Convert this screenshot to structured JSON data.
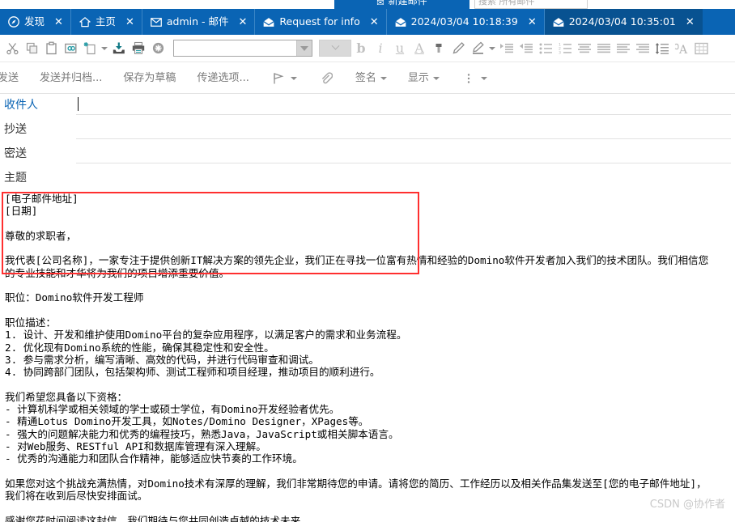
{
  "top_strip": {
    "new_mail_button": "新建邮件",
    "new_mail_icon": "envelope-icon",
    "search_placeholder": "搜索 所有邮件"
  },
  "colors": {
    "tabbar_blue": "#0a64b4",
    "active_tab_blue": "#085291",
    "highlight_red": "#ff2f2f",
    "to_label_blue": "#0a64b4"
  },
  "tabbar": {
    "tabs": [
      {
        "label": "发现",
        "icon": "compass-icon",
        "close": "✕",
        "active": false
      },
      {
        "label": "主页",
        "icon": "home-icon",
        "close": "✕",
        "active": false
      },
      {
        "label": "admin - 邮件",
        "icon": "mail-icon",
        "close": "✕",
        "active": false
      },
      {
        "label": "Request for info",
        "icon": "open-envelope-icon",
        "close": "✕",
        "active": false
      },
      {
        "label": "2024/03/04 10:18:39",
        "icon": "open-envelope-icon",
        "close": "✕",
        "active": false
      },
      {
        "label": "2024/03/04 10:35:01",
        "icon": "open-envelope-icon",
        "close": "✕",
        "active": true
      }
    ]
  },
  "format_toolbar": {
    "icons": [
      "cut-icon",
      "copy-icon",
      "paste-icon",
      "paste-link-icon",
      "new-document-icon",
      "new-document-caret-icon",
      "import-icon",
      "print-icon",
      "delete-icon"
    ],
    "font_family_value": "",
    "font_size_value": "",
    "text_buttons": [
      "b",
      "i",
      "u",
      "A"
    ],
    "right_icons": [
      "text-color-icon",
      "pen-icon",
      "highlighter-icon",
      "highlighter-caret-icon",
      "indent-icon",
      "outdent-icon",
      "bullet-list-icon",
      "numbered-list-icon",
      "align-left-icon",
      "align-center-icon",
      "align-justify-icon",
      "align-right-icon",
      "line-spacing-icon",
      "font-style-icon",
      "table-icon"
    ]
  },
  "action_toolbar": {
    "buttons": [
      {
        "label": "发送",
        "icon": "",
        "caret": false
      },
      {
        "label": "发送并归档...",
        "icon": "",
        "caret": false
      },
      {
        "label": "保存为草稿",
        "icon": "",
        "caret": false
      },
      {
        "label": "传递选项...",
        "icon": "",
        "caret": false
      },
      {
        "label": "",
        "icon": "flag-icon",
        "caret": true
      },
      {
        "label": "",
        "icon": "attachment-icon",
        "caret": false
      },
      {
        "label": "签名",
        "icon": "",
        "caret": true
      },
      {
        "label": "显示",
        "icon": "",
        "caret": true
      },
      {
        "label": "",
        "icon": "more-vertical-icon",
        "caret": true
      }
    ]
  },
  "fields": [
    {
      "label": "收件人",
      "value": "",
      "focused": true
    },
    {
      "label": "抄送",
      "value": "",
      "focused": false
    },
    {
      "label": "密送",
      "value": "",
      "focused": false
    },
    {
      "label": "主题",
      "value": "",
      "focused": false
    }
  ],
  "body": {
    "lines": [
      "[电子邮件地址]",
      "[日期]",
      "",
      "尊敬的求职者，",
      "",
      "我代表[公司名称]，一家专注于提供创新IT解决方案的领先企业，我们正在寻找一位富有热情和经验的Domino软件开发者加入我们的技术团队。我们相信您",
      "的专业技能和才华将为我们的项目增添重要价值。",
      "",
      "职位：Domino软件开发工程师",
      "",
      "职位描述：",
      "1. 设计、开发和维护使用Domino平台的复杂应用程序，以满足客户的需求和业务流程。",
      "2. 优化现有Domino系统的性能，确保其稳定性和安全性。",
      "3. 参与需求分析，编写清晰、高效的代码，并进行代码审查和调试。",
      "4. 协同跨部门团队，包括架构师、测试工程师和项目经理，推动项目的顺利进行。",
      "",
      "我们希望您具备以下资格：",
      "- 计算机科学或相关领域的学士或硕士学位，有Domino开发经验者优先。",
      "- 精通Lotus Domino开发工具，如Notes/Domino Designer，XPages等。",
      "- 强大的问题解决能力和优秀的编程技巧，熟悉Java，JavaScript或相关脚本语言。",
      "- 对Web服务、RESTful API和数据库管理有深入理解。",
      "- 优秀的沟通能力和团队合作精神，能够适应快节奏的工作环境。",
      "",
      "如果您对这个挑战充满热情，对Domino技术有深厚的理解，我们非常期待您的申请。请将您的简历、工作经历以及相关作品集发送至[您的电子邮件地址]，",
      "我们将在收到后尽快安排面试。",
      "",
      "感谢您花时间阅读这封信，我们期待与您共同创造卓越的技术未来。"
    ]
  },
  "watermark": {
    "text": "CSDN @协作者"
  }
}
